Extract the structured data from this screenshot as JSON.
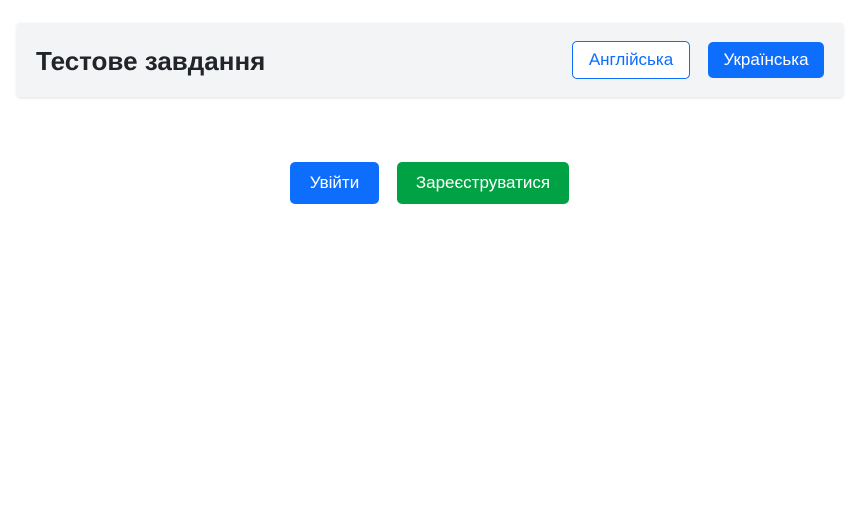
{
  "header": {
    "title": "Тестове завдання",
    "languages": {
      "english_label": "Англійська",
      "ukrainian_label": "Українська"
    }
  },
  "main": {
    "login_label": "Увійти",
    "register_label": "Зареєструватися"
  },
  "colors": {
    "primary": "#0d6efd",
    "success": "#00a243",
    "header_bg": "#f2f4f6",
    "title_text": "#212529"
  }
}
